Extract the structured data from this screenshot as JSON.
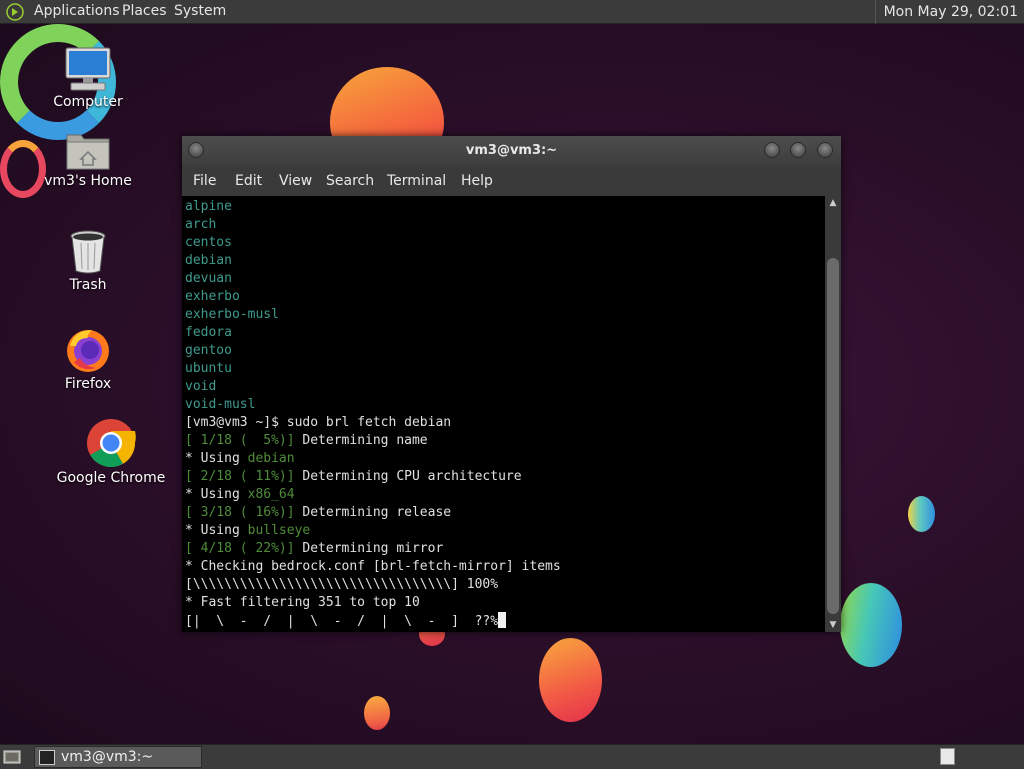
{
  "top_panel": {
    "menus": [
      "Applications",
      "Places",
      "System"
    ],
    "clock": "Mon May 29, 02:01"
  },
  "desktop_icons": [
    {
      "label": "Computer",
      "icon": "computer-icon"
    },
    {
      "label": "vm3's Home",
      "icon": "home-folder-icon"
    },
    {
      "label": "Trash",
      "icon": "trash-icon"
    },
    {
      "label": "Firefox",
      "icon": "firefox-icon"
    },
    {
      "label": "Google Chrome",
      "icon": "chrome-icon"
    }
  ],
  "terminal": {
    "title": "vm3@vm3:~",
    "menu": [
      "File",
      "Edit",
      "View",
      "Search",
      "Terminal",
      "Help"
    ],
    "strata_list": [
      "alpine",
      "arch",
      "centos",
      "debian",
      "devuan",
      "exherbo",
      "exherbo-musl",
      "fedora",
      "gentoo",
      "ubuntu",
      "void",
      "void-musl"
    ],
    "prompt": "[vm3@vm3 ~]$ ",
    "command": "sudo brl fetch debian",
    "steps": [
      {
        "step": "[ 1/18 (  5%)]",
        "text": " Determining name"
      },
      {
        "step": "[ 2/18 ( 11%)]",
        "text": " Determining CPU architecture"
      },
      {
        "step": "[ 3/18 ( 16%)]",
        "text": " Determining release"
      },
      {
        "step": "[ 4/18 ( 22%)]",
        "text": " Determining mirror"
      }
    ],
    "using": [
      {
        "prefix": "* Using ",
        "value": "debian"
      },
      {
        "prefix": "* Using ",
        "value": "x86_64"
      },
      {
        "prefix": "* Using ",
        "value": "bullseye"
      }
    ],
    "checking": "* Checking bedrock.conf [brl-fetch-mirror] items",
    "progress_full": "[\\\\\\\\\\\\\\\\\\\\\\\\\\\\\\\\\\\\\\\\\\\\\\\\\\\\\\\\\\\\\\\\\\] 100%",
    "filtering": "* Fast filtering 351 to top 10",
    "spinner": "[|  \\  -  /  |  \\  -  /  |  \\  -  ]  ??%"
  },
  "taskbar": {
    "task_label": "vm3@vm3:~"
  },
  "colors": {
    "term_teal": "#3f9a8e",
    "term_green": "#4f8c3a",
    "panel": "#3b3b3b"
  }
}
